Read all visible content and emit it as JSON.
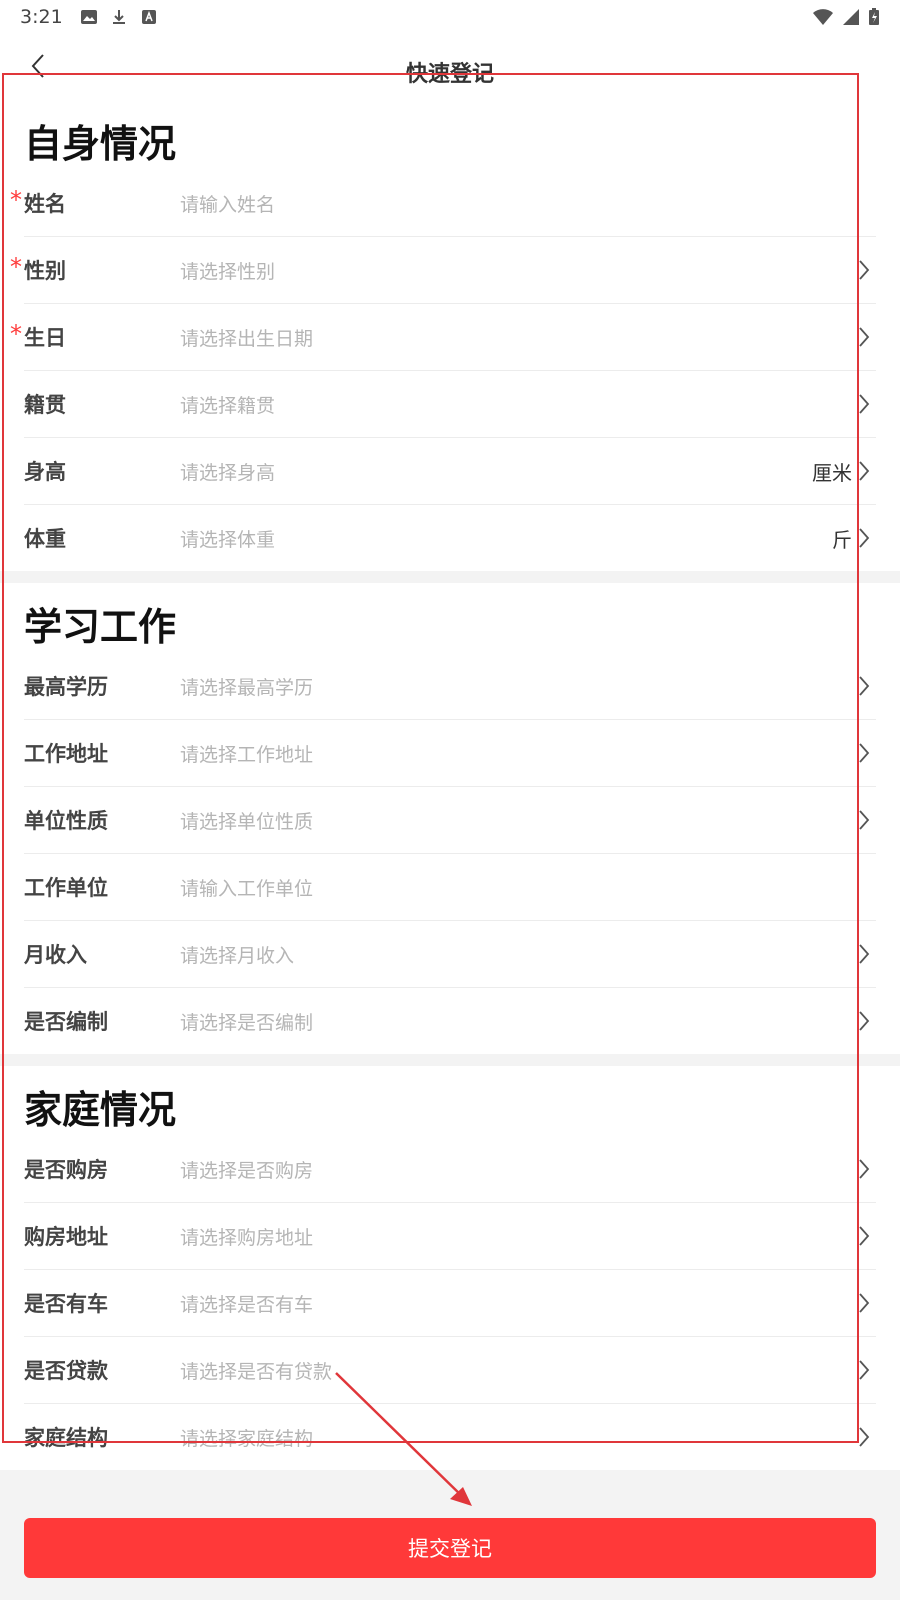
{
  "status_bar": {
    "time": "3:21"
  },
  "nav": {
    "title": "快速登记"
  },
  "sections": [
    {
      "title": "自身情况",
      "rows": [
        {
          "label": "姓名",
          "placeholder": "请输入姓名",
          "required": "*",
          "unit": "",
          "arrow": false
        },
        {
          "label": "性别",
          "placeholder": "请选择性别",
          "required": "*",
          "unit": "",
          "arrow": true
        },
        {
          "label": "生日",
          "placeholder": "请选择出生日期",
          "required": "*",
          "unit": "",
          "arrow": true
        },
        {
          "label": "籍贯",
          "placeholder": "请选择籍贯",
          "required": "",
          "unit": "",
          "arrow": true
        },
        {
          "label": "身高",
          "placeholder": "请选择身高",
          "required": "",
          "unit": "厘米",
          "arrow": true
        },
        {
          "label": "体重",
          "placeholder": "请选择体重",
          "required": "",
          "unit": "斤",
          "arrow": true
        }
      ]
    },
    {
      "title": "学习工作",
      "rows": [
        {
          "label": "最高学历",
          "placeholder": "请选择最高学历",
          "required": "",
          "unit": "",
          "arrow": true
        },
        {
          "label": "工作地址",
          "placeholder": "请选择工作地址",
          "required": "",
          "unit": "",
          "arrow": true
        },
        {
          "label": "单位性质",
          "placeholder": "请选择单位性质",
          "required": "",
          "unit": "",
          "arrow": true
        },
        {
          "label": "工作单位",
          "placeholder": "请输入工作单位",
          "required": "",
          "unit": "",
          "arrow": false
        },
        {
          "label": "月收入",
          "placeholder": "请选择月收入",
          "required": "",
          "unit": "",
          "arrow": true
        },
        {
          "label": "是否编制",
          "placeholder": "请选择是否编制",
          "required": "",
          "unit": "",
          "arrow": true
        }
      ]
    },
    {
      "title": "家庭情况",
      "rows": [
        {
          "label": "是否购房",
          "placeholder": "请选择是否购房",
          "required": "",
          "unit": "",
          "arrow": true
        },
        {
          "label": "购房地址",
          "placeholder": "请选择购房地址",
          "required": "",
          "unit": "",
          "arrow": true
        },
        {
          "label": "是否有车",
          "placeholder": "请选择是否有车",
          "required": "",
          "unit": "",
          "arrow": true
        },
        {
          "label": "是否贷款",
          "placeholder": "请选择是否有贷款",
          "required": "",
          "unit": "",
          "arrow": true
        },
        {
          "label": "家庭结构",
          "placeholder": "请选择家庭结构",
          "required": "",
          "unit": "",
          "arrow": true
        }
      ]
    }
  ],
  "submit": {
    "label": "提交登记"
  },
  "colors": {
    "accent": "#ff3939",
    "annotation": "#e0363a",
    "required": "#ff3b3b"
  }
}
